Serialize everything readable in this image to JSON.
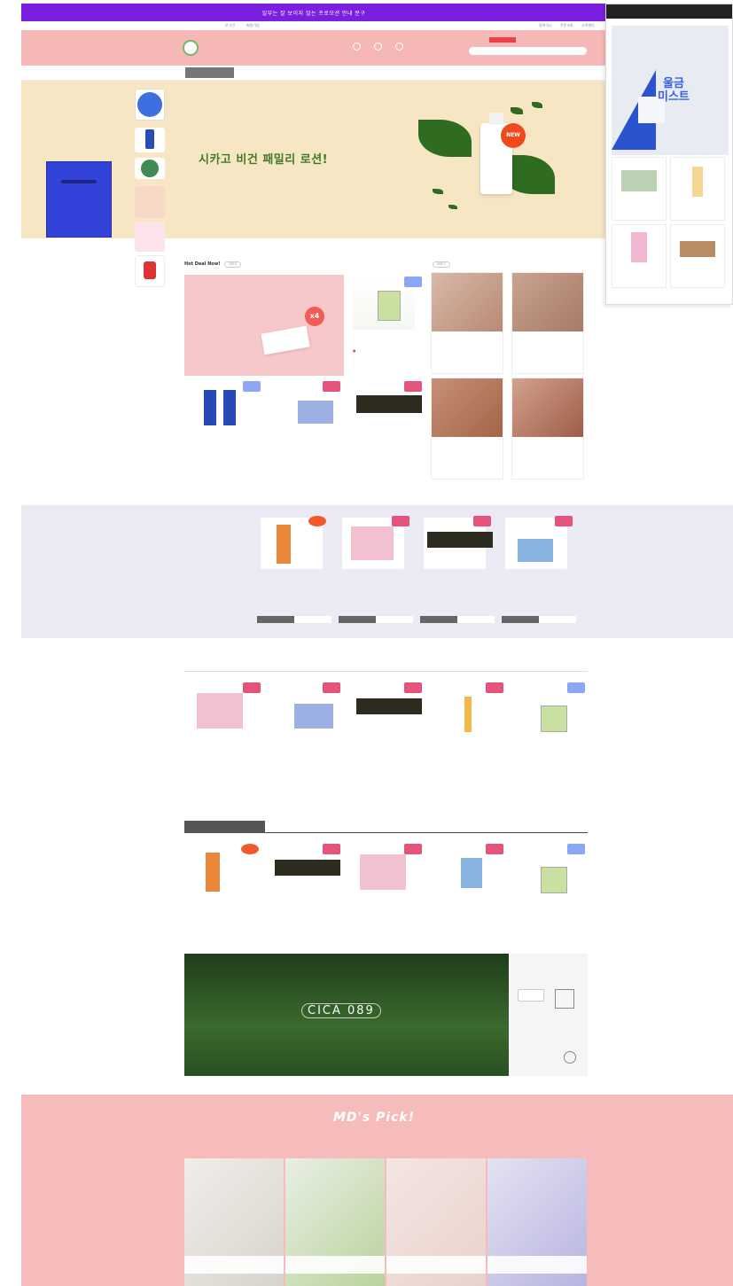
{
  "promo_bar": {
    "text": "일부는 잘 보이지 않는 프로모션 안내 문구",
    "color": "#7a1fe0"
  },
  "utility_links": [
    "로그인",
    "회원가입",
    "장바구니",
    "주문조회",
    "고객센터"
  ],
  "header": {
    "brand_line1": "",
    "brand_line2": "",
    "search_tag": "",
    "search_placeholder": "",
    "color": "#f6b8b6"
  },
  "nav": {
    "category_label": "",
    "left_items": [
      "",
      "",
      "",
      ""
    ],
    "right_items": [
      "",
      "",
      "",
      "",
      ""
    ]
  },
  "hero": {
    "small": "",
    "headline": "시카고 비건 패밀리 로션!",
    "sub": "",
    "badge": "NEW",
    "bg": "#f6e6c4"
  },
  "left_banner": {
    "title": "",
    "btn": ""
  },
  "popup": {
    "header": "",
    "mist_title": "울금\n미스트"
  },
  "hot_deal": {
    "title": "Hot Deal Now!",
    "more": "더보기",
    "banner_line1": "",
    "banner_title": "",
    "banner_badge": "x4"
  },
  "reviews": {
    "title": "",
    "more": "더보기"
  },
  "timesale": {
    "title": ""
  },
  "best": {
    "title": ""
  },
  "category_best": {
    "title": "",
    "tabs": [
      "",
      "",
      "",
      "",
      ""
    ]
  },
  "cica_banner": {
    "small": "",
    "label": "CICA 089"
  },
  "mds_pick": {
    "title": "MD's Pick!",
    "tabs_line": ""
  }
}
